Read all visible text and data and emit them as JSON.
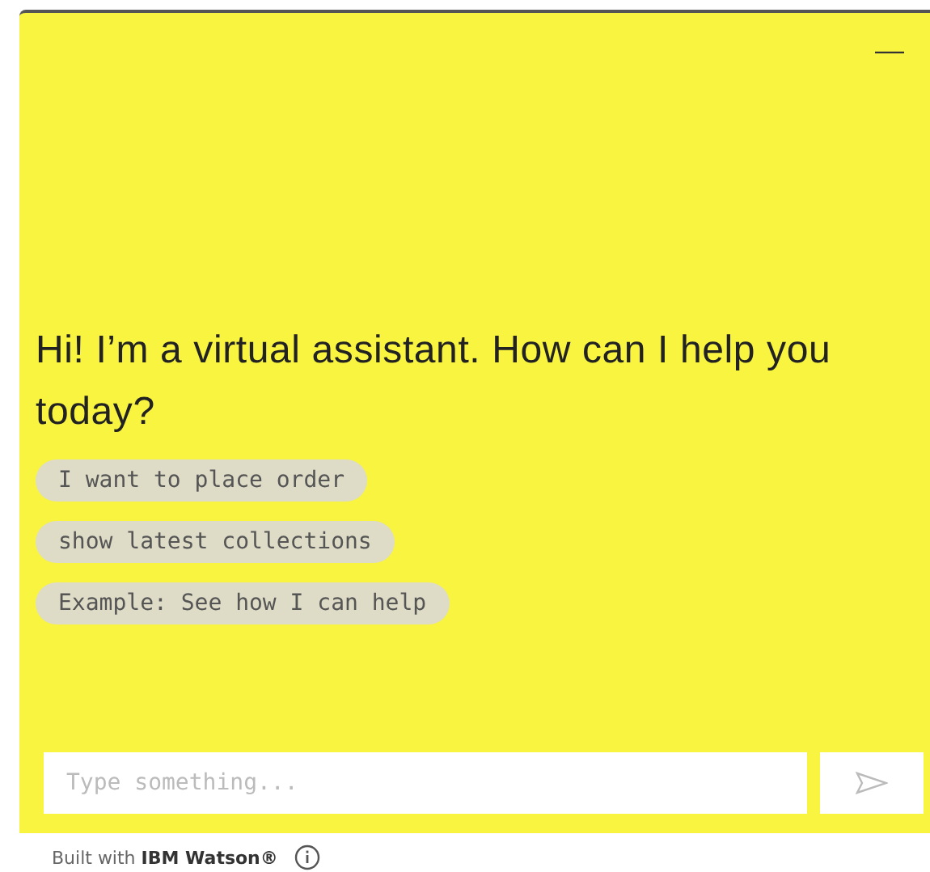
{
  "header": {
    "minimize": "—"
  },
  "greeting": "Hi! I’m a virtual assistant. How can I help you today?",
  "suggestions": [
    "I want to place order",
    "show latest collections",
    "Example: See how I can help"
  ],
  "composer": {
    "placeholder": "Type something..."
  },
  "footer": {
    "text": "Built with **IBM Watson®**"
  }
}
